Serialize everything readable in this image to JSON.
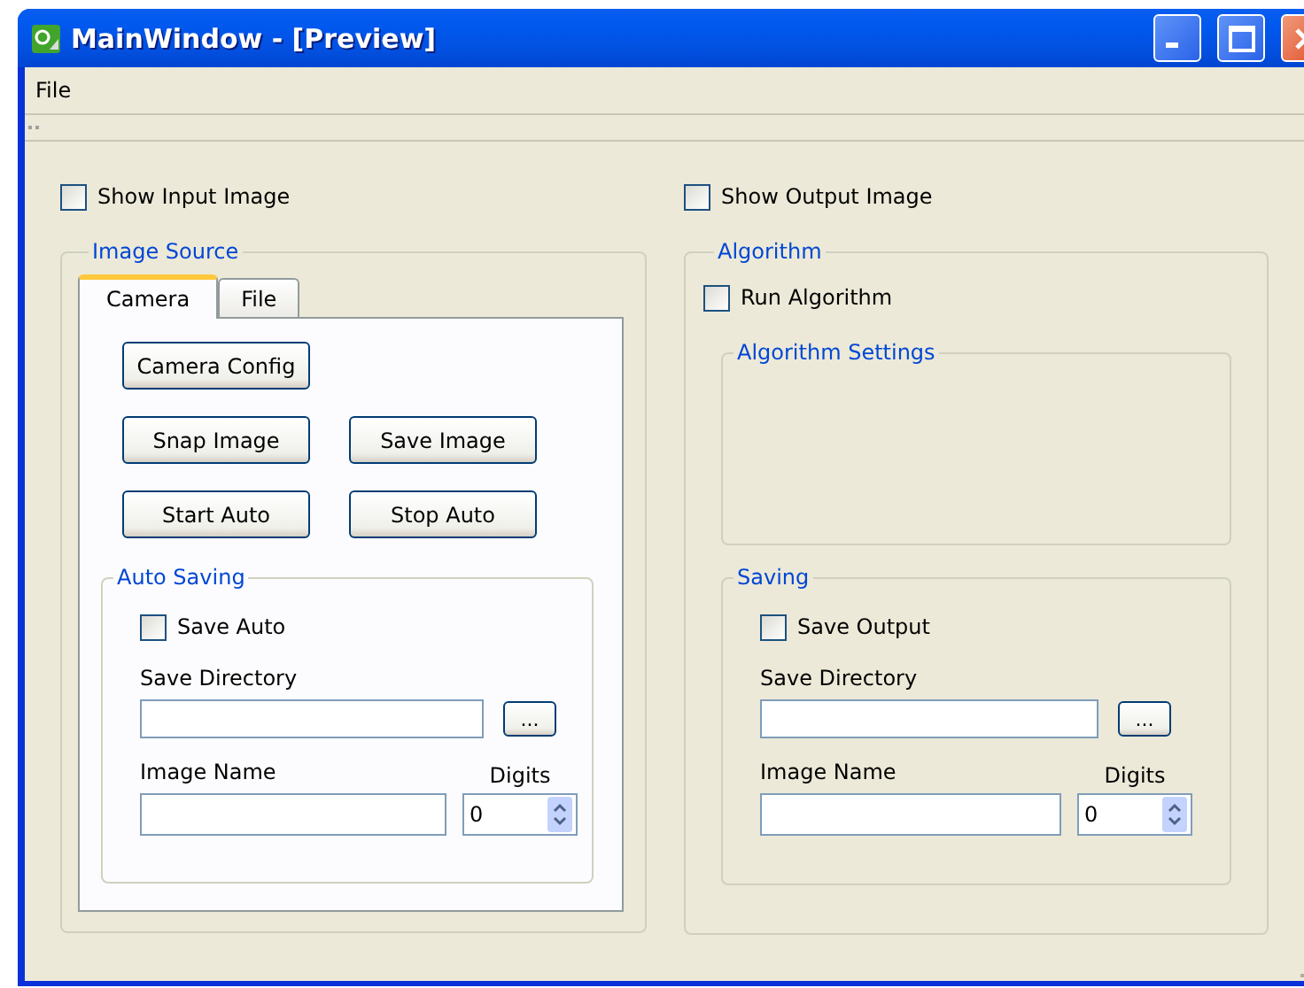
{
  "window": {
    "title": "MainWindow - [Preview]"
  },
  "menu": [
    {
      "label": "File"
    }
  ],
  "input_panel": {
    "show_checkbox": {
      "label": "Show Input Image",
      "checked": false
    },
    "image_source": {
      "title": "Image Source",
      "tabs": [
        {
          "label": "Camera",
          "selected": true
        },
        {
          "label": "File",
          "selected": false
        }
      ],
      "button_rows": [
        [
          "Camera Config"
        ],
        [
          "Snap Image",
          "Save Image"
        ],
        [
          "Start Auto",
          "Stop Auto"
        ]
      ],
      "auto_saving": {
        "title": "Auto Saving",
        "checkbox": {
          "label": "Save Auto",
          "checked": false
        },
        "directory_label": "Save Directory",
        "browse_button": "...",
        "name_label": "Image Name",
        "digits_label": "Digits",
        "digits_value": "0"
      }
    }
  },
  "output_panel": {
    "show_checkbox": {
      "label": "Show Output Image",
      "checked": false
    },
    "algorithm": {
      "title": "Algorithm",
      "run_checkbox": {
        "label": "Run Algorithm",
        "checked": false
      },
      "settings_title": "Algorithm Settings",
      "saving": {
        "title": "Saving",
        "checkbox": {
          "label": "Save Output",
          "checked": false
        },
        "directory_label": "Save Directory",
        "browse_button": "...",
        "name_label": "Image Name",
        "digits_label": "Digits",
        "digits_value": "0"
      }
    }
  }
}
